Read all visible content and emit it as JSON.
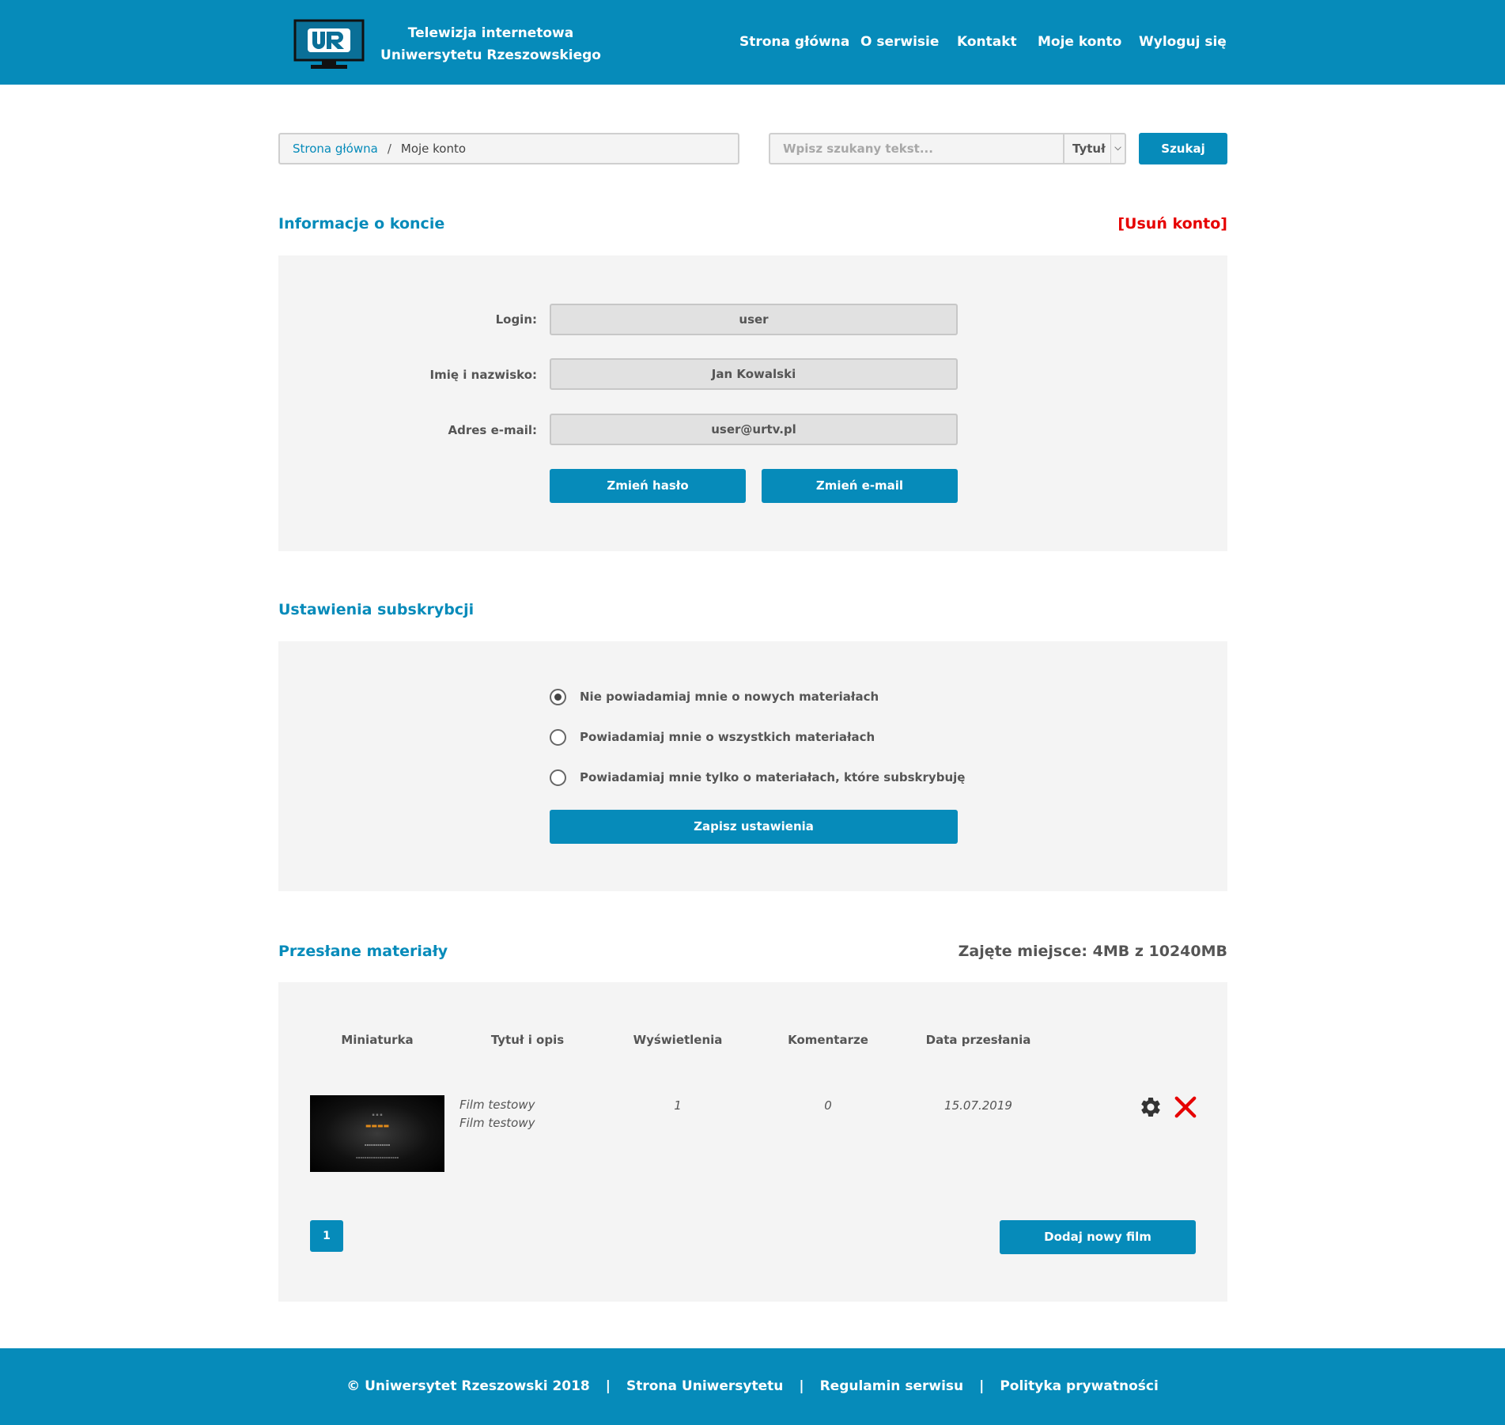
{
  "header": {
    "title_line1": "Telewizja internetowa",
    "title_line2": "Uniwersytetu Rzeszowskiego",
    "nav": [
      "Strona główna",
      "O serwisie",
      "Kontakt",
      "Moje konto",
      "Wyloguj się"
    ]
  },
  "breadcrumb": {
    "home": "Strona główna",
    "separator": "/",
    "current": "Moje konto"
  },
  "search": {
    "placeholder": "Wpisz szukany tekst...",
    "select_value": "Tytuł",
    "button": "Szukaj"
  },
  "account": {
    "section_title": "Informacje o koncie",
    "delete_label": "[Usuń konto]",
    "login_label": "Login:",
    "login_value": "user",
    "name_label": "Imię i nazwisko:",
    "name_value": "Jan Kowalski",
    "email_label": "Adres e-mail:",
    "email_value": "user@urtv.pl",
    "change_password": "Zmień hasło",
    "change_email": "Zmień e-mail"
  },
  "subscription": {
    "section_title": "Ustawienia subskrybcji",
    "options": [
      "Nie powiadamiaj mnie o nowych materiałach",
      "Powiadamiaj mnie o wszystkich materiałach",
      "Powiadamiaj mnie tylko o materiałach, które subskrybuję"
    ],
    "selected_index": 0,
    "save_button": "Zapisz ustawienia"
  },
  "materials": {
    "section_title": "Przesłane materiały",
    "storage": "Zajęte miejsce: 4MB z 10240MB",
    "columns": [
      "Miniaturka",
      "Tytuł i opis",
      "Wyświetlenia",
      "Komentarze",
      "Data przesłania"
    ],
    "rows": [
      {
        "title": "Film testowy",
        "description": "Film testowy",
        "views": "1",
        "comments": "0",
        "date": "15.07.2019"
      }
    ],
    "page": "1",
    "add_button": "Dodaj nowy film"
  },
  "footer": {
    "copyright": "© Uniwersytet Rzeszowski 2018",
    "separator": "|",
    "links": [
      "Strona Uniwersytetu",
      "Regulamin serwisu",
      "Polityka prywatności"
    ]
  },
  "colors": {
    "primary": "#068bba",
    "danger": "#e60000",
    "panel": "#f4f4f4"
  },
  "icons": [
    "ur-tv-logo",
    "gear-icon",
    "close-icon",
    "chevron-down-icon"
  ]
}
